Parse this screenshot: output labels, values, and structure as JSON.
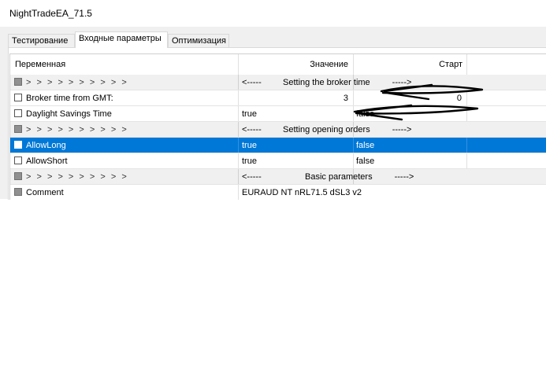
{
  "window": {
    "title": "NightTradeEA_71.5"
  },
  "tabs": [
    {
      "label": "Тестирование",
      "active": false
    },
    {
      "label": "Входные параметры",
      "active": true
    },
    {
      "label": "Оптимизация",
      "active": false
    }
  ],
  "columns": {
    "variable": "Переменная",
    "value": "Значение",
    "start": "Старт"
  },
  "rows": [
    {
      "type": "group",
      "name": "> > > > > > > > > >",
      "value": "<-----",
      "start": "Setting the broker time",
      "tail": "----->"
    },
    {
      "type": "param",
      "name": "Broker time from GMT:",
      "value": "3",
      "start": "0"
    },
    {
      "type": "param",
      "name": "Daylight Savings Time",
      "value": "true",
      "start": "false"
    },
    {
      "type": "group",
      "name": "> > > > > > > > > >",
      "value": "<-----",
      "start": "Setting opening orders",
      "tail": "----->"
    },
    {
      "type": "param",
      "name": "AllowLong",
      "value": "true",
      "start": "false",
      "selected": true
    },
    {
      "type": "param",
      "name": "AllowShort",
      "value": "true",
      "start": "false"
    },
    {
      "type": "group",
      "name": "> > > > > > > > > >",
      "value": "<-----",
      "start": "Basic parameters",
      "tail": "----->"
    },
    {
      "type": "param",
      "name": "Comment",
      "value": "EURAUD NT nRL71.5 dSL3 v2",
      "start": ""
    }
  ],
  "colors": {
    "selection": "#0078d7",
    "group_row": "#f0f0f0",
    "annotation": "#000000"
  }
}
